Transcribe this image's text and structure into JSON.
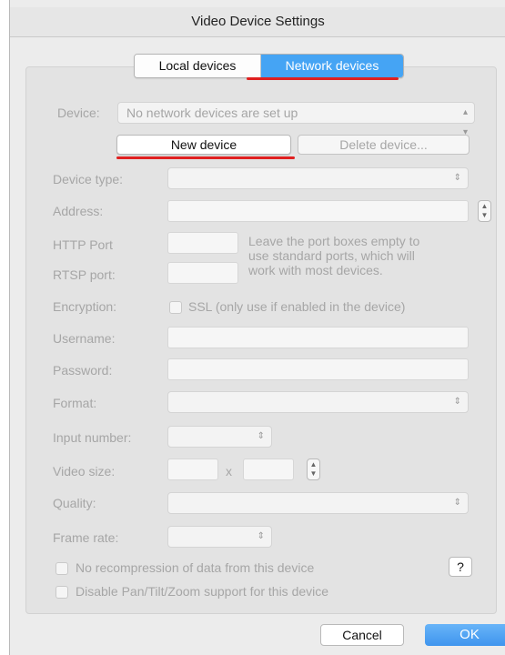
{
  "window": {
    "title": "Video Device Settings"
  },
  "tabs": {
    "local": "Local devices",
    "network": "Network devices"
  },
  "device": {
    "label": "Device:",
    "value": "No network devices are set up",
    "new_button": "New device",
    "delete_button": "Delete device..."
  },
  "form": {
    "device_type_label": "Device type:",
    "address_label": "Address:",
    "http_label": "HTTP Port",
    "rtsp_label": "RTSP port:",
    "port_hint_1": "Leave the port boxes empty to",
    "port_hint_2": "use standard ports, which will",
    "port_hint_3": "work with most devices.",
    "encryption_label": "Encryption:",
    "ssl_label": "SSL (only use if enabled in the device)",
    "username_label": "Username:",
    "password_label": "Password:",
    "format_label": "Format:",
    "input_number_label": "Input number:",
    "video_size_label": "Video size:",
    "video_size_x": "x",
    "quality_label": "Quality:",
    "frame_rate_label": "Frame rate:"
  },
  "options": {
    "no_recompression": "No recompression of data from this device",
    "disable_ptz": "Disable Pan/Tilt/Zoom support for this device",
    "help": "?"
  },
  "footer": {
    "cancel": "Cancel",
    "ok": "OK"
  },
  "colors": {
    "accent": "#45a4f4",
    "annotation": "#e02020"
  }
}
